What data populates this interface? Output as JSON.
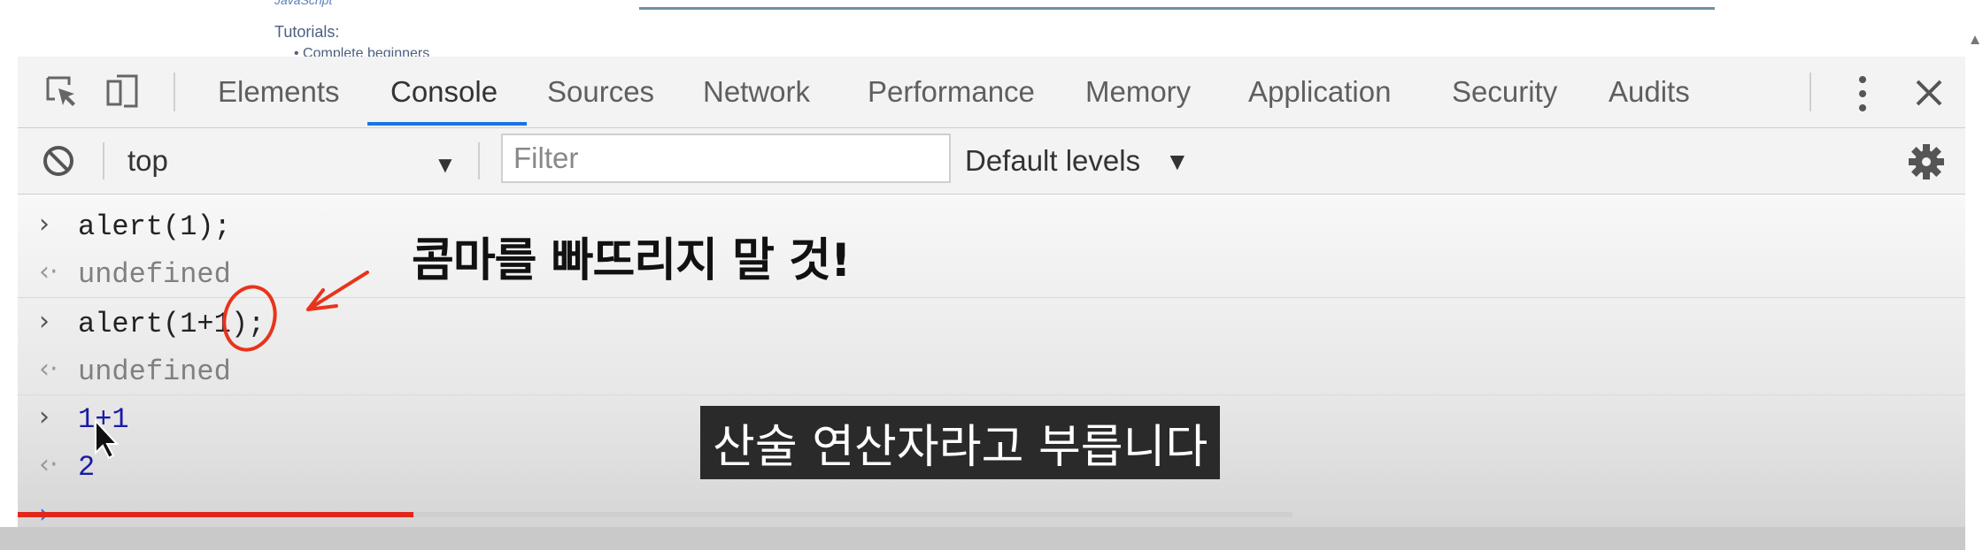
{
  "page_strip": {
    "crumb": "JavaScript",
    "tutorials_label": "Tutorials:",
    "tutorials_item": "Complete beginners"
  },
  "devtools": {
    "tabs": [
      "Elements",
      "Console",
      "Sources",
      "Network",
      "Performance",
      "Memory",
      "Application",
      "Security",
      "Audits"
    ],
    "active_tab": "Console",
    "accent_color": "#1a73e8"
  },
  "console_toolbar": {
    "context": "top",
    "filter_placeholder": "Filter",
    "levels": "Default levels"
  },
  "console_rows": [
    {
      "type": "input",
      "text": "alert(1);"
    },
    {
      "type": "output",
      "text": "undefined"
    },
    {
      "type": "input",
      "text": "alert(1+1);"
    },
    {
      "type": "output",
      "text": "undefined"
    },
    {
      "type": "input",
      "text": "1+1"
    },
    {
      "type": "output",
      "text": "2"
    }
  ],
  "annotation": {
    "note": "콤마를 빠뜨리지 말 것!",
    "subtitle": "산술 연산자라고 부릅니다"
  },
  "video": {
    "progress_fraction": 0.32,
    "buffered_fraction": 0.69,
    "progress_color": "#e1261c"
  }
}
